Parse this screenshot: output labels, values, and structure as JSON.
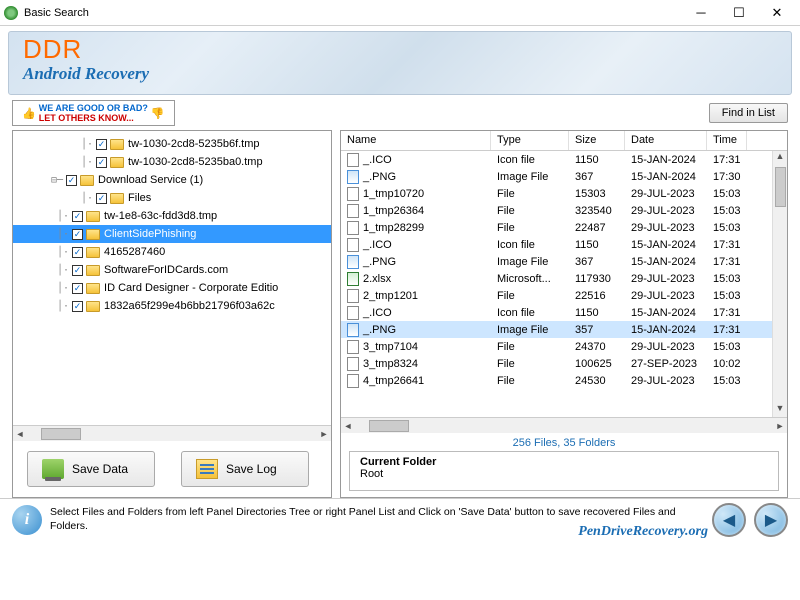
{
  "titlebar": {
    "title": "Basic Search"
  },
  "banner": {
    "ddr": "DDR",
    "subtitle": "Android Recovery"
  },
  "toolbar": {
    "feedback_l1": "WE ARE GOOD OR BAD?",
    "feedback_l2": "LET OTHERS KNOW...",
    "find": "Find in List"
  },
  "tree": {
    "items": [
      {
        "indent": 68,
        "label": "tw-1030-2cd8-5235b6f.tmp"
      },
      {
        "indent": 68,
        "label": "tw-1030-2cd8-5235ba0.tmp"
      },
      {
        "indent": 38,
        "expand": true,
        "label": "Download Service (1)"
      },
      {
        "indent": 68,
        "label": "Files"
      },
      {
        "indent": 44,
        "label": "tw-1e8-63c-fdd3d8.tmp"
      },
      {
        "indent": 44,
        "label": "ClientSidePhishing",
        "selected": true
      },
      {
        "indent": 44,
        "label": "4165287460"
      },
      {
        "indent": 44,
        "label": "SoftwareForIDCards.com"
      },
      {
        "indent": 44,
        "label": "ID Card Designer - Corporate Editio"
      },
      {
        "indent": 44,
        "label": "1832a65f299e4b6bb21796f03a62c"
      }
    ]
  },
  "buttons": {
    "save_data": "Save Data",
    "save_log": "Save Log"
  },
  "list": {
    "headers": {
      "name": "Name",
      "type": "Type",
      "size": "Size",
      "date": "Date",
      "time": "Time"
    },
    "rows": [
      {
        "ico": "file",
        "name": "_.ICO",
        "type": "Icon file",
        "size": "1150",
        "date": "15-JAN-2024",
        "time": "17:31"
      },
      {
        "ico": "img",
        "name": "_.PNG",
        "type": "Image File",
        "size": "367",
        "date": "15-JAN-2024",
        "time": "17:30"
      },
      {
        "ico": "file",
        "name": "1_tmp10720",
        "type": "File",
        "size": "15303",
        "date": "29-JUL-2023",
        "time": "15:03"
      },
      {
        "ico": "file",
        "name": "1_tmp26364",
        "type": "File",
        "size": "323540",
        "date": "29-JUL-2023",
        "time": "15:03"
      },
      {
        "ico": "file",
        "name": "1_tmp28299",
        "type": "File",
        "size": "22487",
        "date": "29-JUL-2023",
        "time": "15:03"
      },
      {
        "ico": "file",
        "name": "_.ICO",
        "type": "Icon file",
        "size": "1150",
        "date": "15-JAN-2024",
        "time": "17:31"
      },
      {
        "ico": "img",
        "name": "_.PNG",
        "type": "Image File",
        "size": "367",
        "date": "15-JAN-2024",
        "time": "17:31"
      },
      {
        "ico": "xls",
        "name": "2.xlsx",
        "type": "Microsoft...",
        "size": "117930",
        "date": "29-JUL-2023",
        "time": "15:03"
      },
      {
        "ico": "file",
        "name": "2_tmp1201",
        "type": "File",
        "size": "22516",
        "date": "29-JUL-2023",
        "time": "15:03"
      },
      {
        "ico": "file",
        "name": "_.ICO",
        "type": "Icon file",
        "size": "1150",
        "date": "15-JAN-2024",
        "time": "17:31"
      },
      {
        "ico": "img",
        "name": "_.PNG",
        "type": "Image File",
        "size": "357",
        "date": "15-JAN-2024",
        "time": "17:31",
        "selected": true
      },
      {
        "ico": "file",
        "name": "3_tmp7104",
        "type": "File",
        "size": "24370",
        "date": "29-JUL-2023",
        "time": "15:03"
      },
      {
        "ico": "file",
        "name": "3_tmp8324",
        "type": "File",
        "size": "100625",
        "date": "27-SEP-2023",
        "time": "10:02"
      },
      {
        "ico": "file",
        "name": "4_tmp26641",
        "type": "File",
        "size": "24530",
        "date": "29-JUL-2023",
        "time": "15:03"
      }
    ]
  },
  "status": {
    "stats": "256 Files, 35 Folders",
    "curfolder_label": "Current Folder",
    "curfolder_value": "Root"
  },
  "footer": {
    "text": "Select Files and Folders from left Panel Directories Tree or right Panel List and Click on 'Save Data' button to save recovered Files and Folders.",
    "watermark": "PenDriveRecovery.org"
  }
}
